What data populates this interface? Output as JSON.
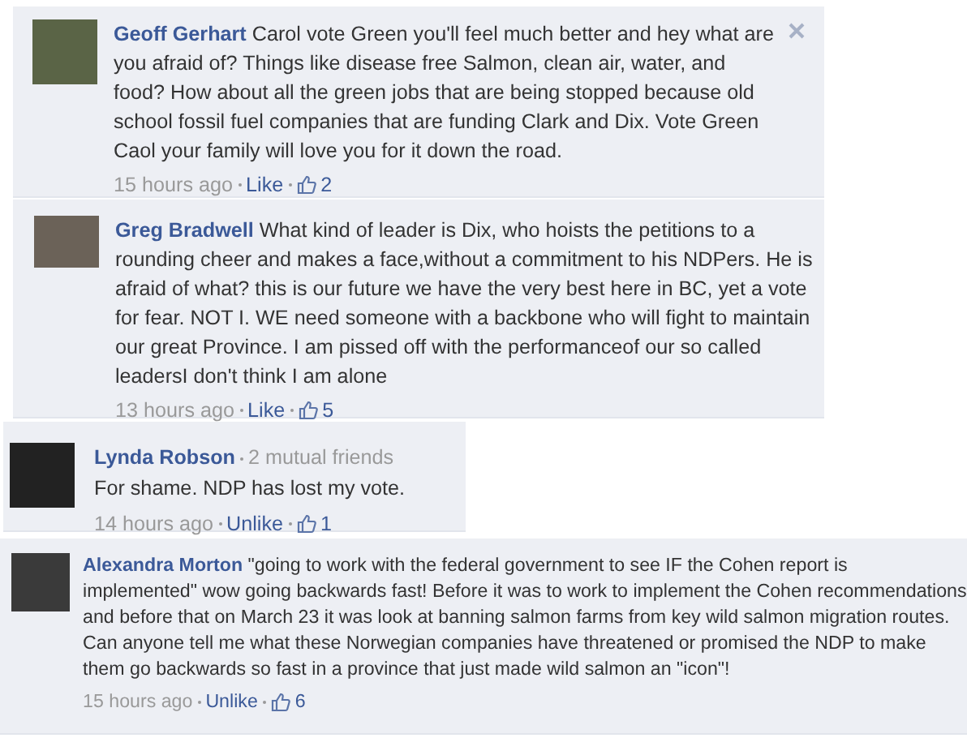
{
  "comments": [
    {
      "author": "Geoff Gerhart",
      "text": "Carol vote Green you'll feel much better and hey what are you afraid of? Things like disease free Salmon, clean air, water, and food? How about all the green jobs that are being stopped because old school fossil fuel companies that are funding Clark and Dix. Vote Green Caol your family will love you for it down the road.",
      "time": "15 hours ago",
      "like_label": "Like",
      "like_count": "2",
      "removable": true
    },
    {
      "author": "Greg Bradwell",
      "text": "What kind of leader is Dix, who hoists the petitions to a rounding cheer and makes a face,without a commitment to his NDPers. He is afraid of what? this is our future we have the very best here in BC, yet a vote for fear. NOT I. WE need someone with a backbone who will fight to maintain our great Province. I am pissed off with the performanceof our so called leadersI don't think I am alone",
      "time": "13 hours ago",
      "like_label": "Like",
      "like_count": "5",
      "removable": false
    },
    {
      "author": "Lynda Robson",
      "subtitle": "2 mutual friends",
      "text": "For shame. NDP has lost my vote.",
      "time": "14 hours ago",
      "like_label": "Unlike",
      "like_count": "1",
      "removable": false
    },
    {
      "author": "Alexandra Morton",
      "text": "\"going to work with the federal government to see IF the Cohen report is implemented\" wow going backwards fast! Before it was to work to implement the Cohen recommendations and before that on March 23 it was look at banning salmon farms from key wild salmon migration routes. Can anyone tell me what these Norwegian companies have threatened or promised the NDP to make them go backwards so fast in a province that just made wild salmon an \"icon\"!",
      "time": "15 hours ago",
      "like_label": "Unlike",
      "like_count": "6",
      "removable": false
    }
  ]
}
